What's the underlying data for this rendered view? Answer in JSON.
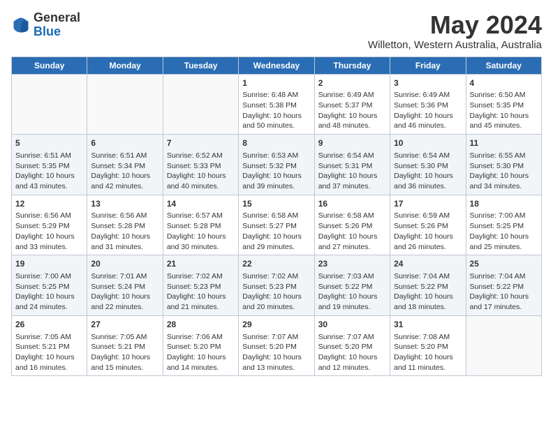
{
  "header": {
    "logo_general": "General",
    "logo_blue": "Blue",
    "month_title": "May 2024",
    "location": "Willetton, Western Australia, Australia"
  },
  "weekdays": [
    "Sunday",
    "Monday",
    "Tuesday",
    "Wednesday",
    "Thursday",
    "Friday",
    "Saturday"
  ],
  "weeks": [
    [
      {
        "day": "",
        "info": ""
      },
      {
        "day": "",
        "info": ""
      },
      {
        "day": "",
        "info": ""
      },
      {
        "day": "1",
        "info": "Sunrise: 6:48 AM\nSunset: 5:38 PM\nDaylight: 10 hours\nand 50 minutes."
      },
      {
        "day": "2",
        "info": "Sunrise: 6:49 AM\nSunset: 5:37 PM\nDaylight: 10 hours\nand 48 minutes."
      },
      {
        "day": "3",
        "info": "Sunrise: 6:49 AM\nSunset: 5:36 PM\nDaylight: 10 hours\nand 46 minutes."
      },
      {
        "day": "4",
        "info": "Sunrise: 6:50 AM\nSunset: 5:35 PM\nDaylight: 10 hours\nand 45 minutes."
      }
    ],
    [
      {
        "day": "5",
        "info": "Sunrise: 6:51 AM\nSunset: 5:35 PM\nDaylight: 10 hours\nand 43 minutes."
      },
      {
        "day": "6",
        "info": "Sunrise: 6:51 AM\nSunset: 5:34 PM\nDaylight: 10 hours\nand 42 minutes."
      },
      {
        "day": "7",
        "info": "Sunrise: 6:52 AM\nSunset: 5:33 PM\nDaylight: 10 hours\nand 40 minutes."
      },
      {
        "day": "8",
        "info": "Sunrise: 6:53 AM\nSunset: 5:32 PM\nDaylight: 10 hours\nand 39 minutes."
      },
      {
        "day": "9",
        "info": "Sunrise: 6:54 AM\nSunset: 5:31 PM\nDaylight: 10 hours\nand 37 minutes."
      },
      {
        "day": "10",
        "info": "Sunrise: 6:54 AM\nSunset: 5:30 PM\nDaylight: 10 hours\nand 36 minutes."
      },
      {
        "day": "11",
        "info": "Sunrise: 6:55 AM\nSunset: 5:30 PM\nDaylight: 10 hours\nand 34 minutes."
      }
    ],
    [
      {
        "day": "12",
        "info": "Sunrise: 6:56 AM\nSunset: 5:29 PM\nDaylight: 10 hours\nand 33 minutes."
      },
      {
        "day": "13",
        "info": "Sunrise: 6:56 AM\nSunset: 5:28 PM\nDaylight: 10 hours\nand 31 minutes."
      },
      {
        "day": "14",
        "info": "Sunrise: 6:57 AM\nSunset: 5:28 PM\nDaylight: 10 hours\nand 30 minutes."
      },
      {
        "day": "15",
        "info": "Sunrise: 6:58 AM\nSunset: 5:27 PM\nDaylight: 10 hours\nand 29 minutes."
      },
      {
        "day": "16",
        "info": "Sunrise: 6:58 AM\nSunset: 5:26 PM\nDaylight: 10 hours\nand 27 minutes."
      },
      {
        "day": "17",
        "info": "Sunrise: 6:59 AM\nSunset: 5:26 PM\nDaylight: 10 hours\nand 26 minutes."
      },
      {
        "day": "18",
        "info": "Sunrise: 7:00 AM\nSunset: 5:25 PM\nDaylight: 10 hours\nand 25 minutes."
      }
    ],
    [
      {
        "day": "19",
        "info": "Sunrise: 7:00 AM\nSunset: 5:25 PM\nDaylight: 10 hours\nand 24 minutes."
      },
      {
        "day": "20",
        "info": "Sunrise: 7:01 AM\nSunset: 5:24 PM\nDaylight: 10 hours\nand 22 minutes."
      },
      {
        "day": "21",
        "info": "Sunrise: 7:02 AM\nSunset: 5:23 PM\nDaylight: 10 hours\nand 21 minutes."
      },
      {
        "day": "22",
        "info": "Sunrise: 7:02 AM\nSunset: 5:23 PM\nDaylight: 10 hours\nand 20 minutes."
      },
      {
        "day": "23",
        "info": "Sunrise: 7:03 AM\nSunset: 5:22 PM\nDaylight: 10 hours\nand 19 minutes."
      },
      {
        "day": "24",
        "info": "Sunrise: 7:04 AM\nSunset: 5:22 PM\nDaylight: 10 hours\nand 18 minutes."
      },
      {
        "day": "25",
        "info": "Sunrise: 7:04 AM\nSunset: 5:22 PM\nDaylight: 10 hours\nand 17 minutes."
      }
    ],
    [
      {
        "day": "26",
        "info": "Sunrise: 7:05 AM\nSunset: 5:21 PM\nDaylight: 10 hours\nand 16 minutes."
      },
      {
        "day": "27",
        "info": "Sunrise: 7:05 AM\nSunset: 5:21 PM\nDaylight: 10 hours\nand 15 minutes."
      },
      {
        "day": "28",
        "info": "Sunrise: 7:06 AM\nSunset: 5:20 PM\nDaylight: 10 hours\nand 14 minutes."
      },
      {
        "day": "29",
        "info": "Sunrise: 7:07 AM\nSunset: 5:20 PM\nDaylight: 10 hours\nand 13 minutes."
      },
      {
        "day": "30",
        "info": "Sunrise: 7:07 AM\nSunset: 5:20 PM\nDaylight: 10 hours\nand 12 minutes."
      },
      {
        "day": "31",
        "info": "Sunrise: 7:08 AM\nSunset: 5:20 PM\nDaylight: 10 hours\nand 11 minutes."
      },
      {
        "day": "",
        "info": ""
      }
    ]
  ]
}
